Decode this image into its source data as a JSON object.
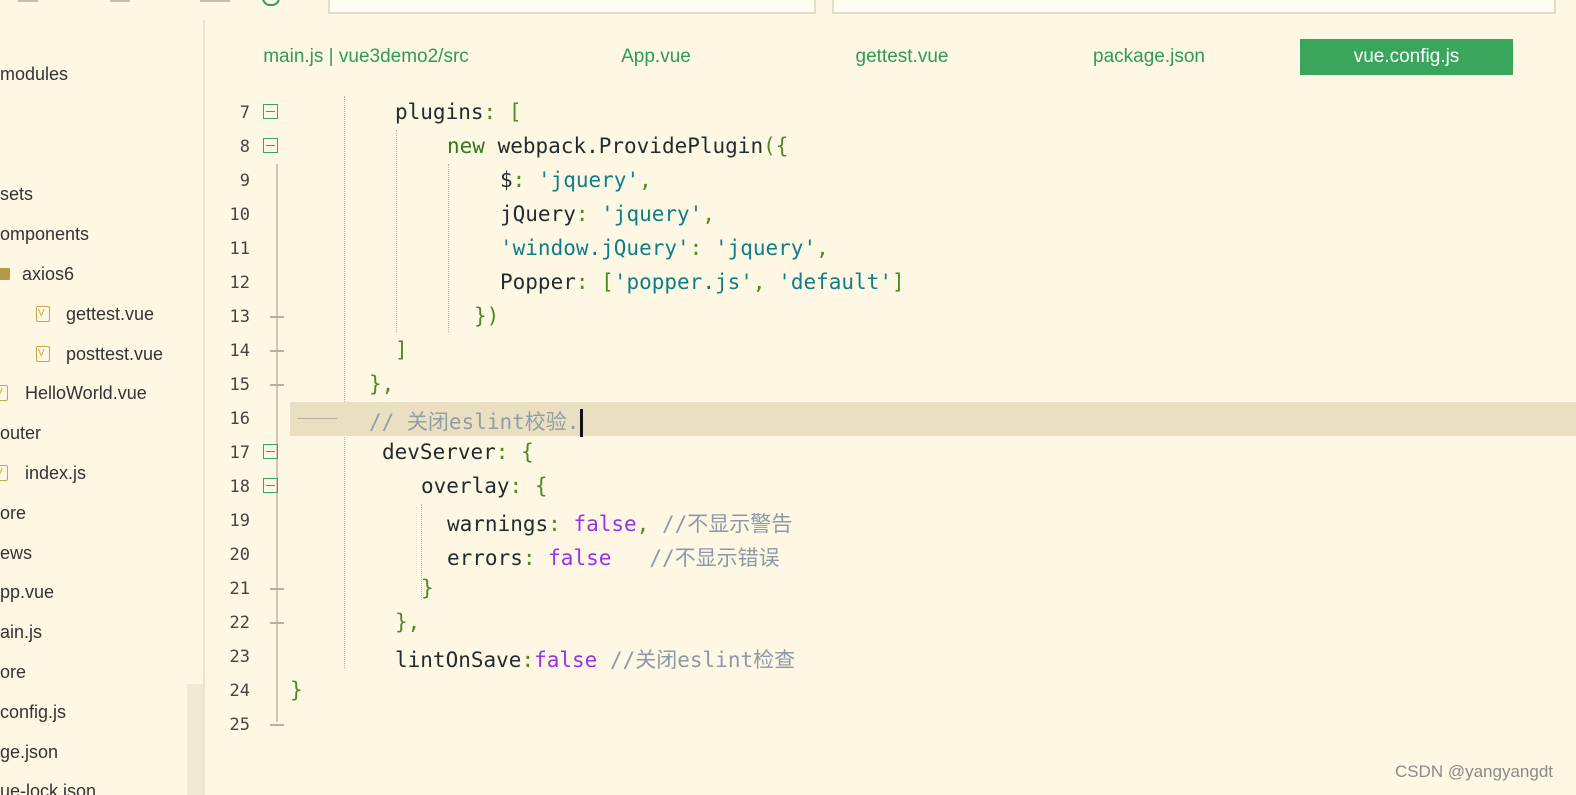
{
  "sidebar": {
    "items": [
      {
        "label": "modules",
        "icon": "none"
      },
      {
        "label": "sets",
        "icon": "none"
      },
      {
        "label": "omponents",
        "icon": "none"
      },
      {
        "label": "axios6",
        "icon": "folder-icon"
      },
      {
        "label": "gettest.vue",
        "icon": "vue-file-icon"
      },
      {
        "label": "posttest.vue",
        "icon": "vue-file-icon"
      },
      {
        "label": "HelloWorld.vue",
        "icon": "vue-file-icon"
      },
      {
        "label": "outer",
        "icon": "none"
      },
      {
        "label": "index.js",
        "icon": "file-icon"
      },
      {
        "label": "ore",
        "icon": "none"
      },
      {
        "label": "ews",
        "icon": "none"
      },
      {
        "label": "pp.vue",
        "icon": "none"
      },
      {
        "label": "ain.js",
        "icon": "none"
      },
      {
        "label": "ore",
        "icon": "none"
      },
      {
        "label": "config.js",
        "icon": "none"
      },
      {
        "label": "ge.json",
        "icon": "none"
      },
      {
        "label": "ue-lock.json",
        "icon": "none"
      }
    ]
  },
  "tabs": [
    {
      "label": "main.js | vue3demo2/src",
      "active": false
    },
    {
      "label": "App.vue",
      "active": false
    },
    {
      "label": "gettest.vue",
      "active": false
    },
    {
      "label": "package.json",
      "active": false
    },
    {
      "label": "vue.config.js",
      "active": true
    }
  ],
  "code": {
    "lines": [
      {
        "n": "7",
        "fold": "open"
      },
      {
        "n": "8",
        "fold": "open"
      },
      {
        "n": "9",
        "fold": "none"
      },
      {
        "n": "10",
        "fold": "none"
      },
      {
        "n": "11",
        "fold": "none"
      },
      {
        "n": "12",
        "fold": "none"
      },
      {
        "n": "13",
        "fold": "end"
      },
      {
        "n": "14",
        "fold": "end"
      },
      {
        "n": "15",
        "fold": "end"
      },
      {
        "n": "16",
        "fold": "none"
      },
      {
        "n": "17",
        "fold": "open"
      },
      {
        "n": "18",
        "fold": "open"
      },
      {
        "n": "19",
        "fold": "none"
      },
      {
        "n": "20",
        "fold": "none"
      },
      {
        "n": "21",
        "fold": "end"
      },
      {
        "n": "22",
        "fold": "end"
      },
      {
        "n": "23",
        "fold": "none"
      },
      {
        "n": "24",
        "fold": "none"
      },
      {
        "n": "25",
        "fold": "end"
      }
    ],
    "t7": {
      "key": "plugins",
      "colon": ": ",
      "bracket": "["
    },
    "t8": {
      "kw": "new",
      "obj": " webpack.ProvidePlugin",
      "open": "({"
    },
    "t9": {
      "key": "$",
      "colon": ": ",
      "val": "'jquery'",
      "comma": ","
    },
    "t10": {
      "key": "jQuery",
      "colon": ": ",
      "val": "'jquery'",
      "comma": ","
    },
    "t11": {
      "key": "'window.jQuery'",
      "colon": ": ",
      "val": "'jquery'",
      "comma": ","
    },
    "t12": {
      "key": "Popper",
      "colon": ": ",
      "open": "[",
      "v1": "'popper.js'",
      "sep": ", ",
      "v2": "'default'",
      "close": "]"
    },
    "t13": "})",
    "t14": "]",
    "t15": "},",
    "t16": {
      "comment": "// 关闭eslint校验."
    },
    "t17": {
      "key": "devServer",
      "colon": ": ",
      "open": "{"
    },
    "t18": {
      "key": "overlay",
      "colon": ": ",
      "open": "{"
    },
    "t19": {
      "key": "warnings",
      "colon": ": ",
      "val": "false",
      "comma": ", ",
      "comment": "//不显示警告"
    },
    "t20": {
      "key": "errors",
      "colon": ": ",
      "val": "false",
      "gap": "   ",
      "comment": "//不显示错误"
    },
    "t21": "}",
    "t22": "},",
    "t23": {
      "key": "lintOnSave",
      "colon": ":",
      "val": "false",
      "gap": " ",
      "comment": "//关闭eslint检查"
    },
    "t24": "}"
  },
  "watermark": "CSDN @yangyangdt",
  "colors": {
    "accent": "#3aa65b",
    "background": "#fdf7e4",
    "current_line": "#eadfc1",
    "string": "#0f7e86",
    "boolean": "#9a32e6",
    "comment": "#8a9aa8"
  }
}
